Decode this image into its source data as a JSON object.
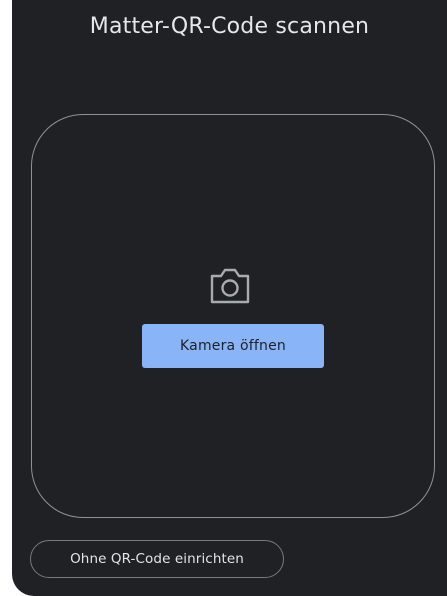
{
  "header": {
    "title": "Matter-QR-Code scannen"
  },
  "scanner": {
    "camera_icon": "camera-icon",
    "open_camera_label": "Kamera öffnen"
  },
  "footer": {
    "no_qr_label": "Ohne QR-Code einrichten"
  },
  "colors": {
    "background": "#1f2124",
    "accent": "#8ab4f8",
    "frame_border": "#8f9296",
    "text": "#e6e7ea"
  }
}
